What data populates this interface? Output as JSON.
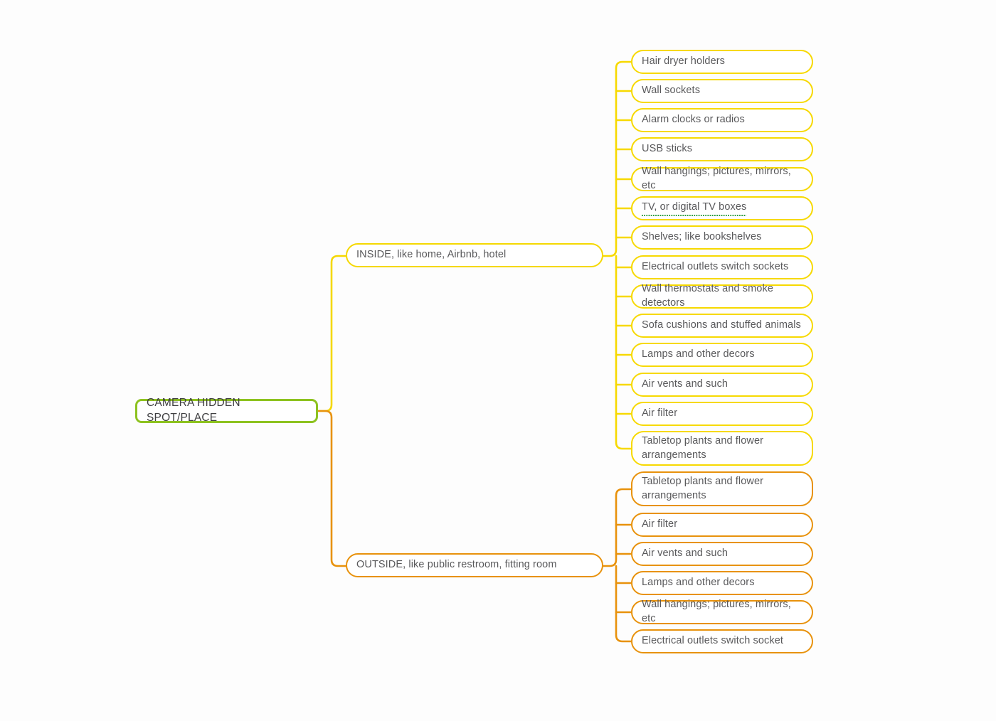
{
  "diagram": {
    "type": "mind-map",
    "background_color": "#fdfdfd",
    "text_color": "#59595b",
    "root": {
      "label": "CAMERA HIDDEN SPOT/PLACE",
      "color": "#8dc220"
    },
    "branches": [
      {
        "id": "inside",
        "label": "INSIDE, like home, Airbnb, hotel",
        "color": "#f5d800",
        "leaves": [
          {
            "label": "Hair dryer holders"
          },
          {
            "label": "Wall sockets"
          },
          {
            "label": "Alarm clocks or radios"
          },
          {
            "label": "USB sticks"
          },
          {
            "label": "Wall hangings; pictures, mirrors, etc"
          },
          {
            "label": "TV, or digital TV boxes",
            "annotation": "spellcheck-underline",
            "annotation_color": "#2e9e43"
          },
          {
            "label": "Shelves; like bookshelves"
          },
          {
            "label": "Electrical outlets switch sockets"
          },
          {
            "label": "Wall thermostats and smoke detectors"
          },
          {
            "label": "Sofa cushions and stuffed animals"
          },
          {
            "label": "Lamps and other decors"
          },
          {
            "label": "Air vents and such"
          },
          {
            "label": "Air filter"
          },
          {
            "label": "Tabletop plants and flower\narrangements"
          }
        ]
      },
      {
        "id": "outside",
        "label": "OUTSIDE, like public restroom, fitting room",
        "color": "#e8920c",
        "leaves": [
          {
            "label": "Tabletop plants and flower\narrangements"
          },
          {
            "label": "Air filter"
          },
          {
            "label": "Air vents and such"
          },
          {
            "label": "Lamps and other decors"
          },
          {
            "label": "Wall hangings; pictures, mirrors, etc"
          },
          {
            "label": "Electrical outlets switch socket"
          }
        ]
      }
    ]
  }
}
